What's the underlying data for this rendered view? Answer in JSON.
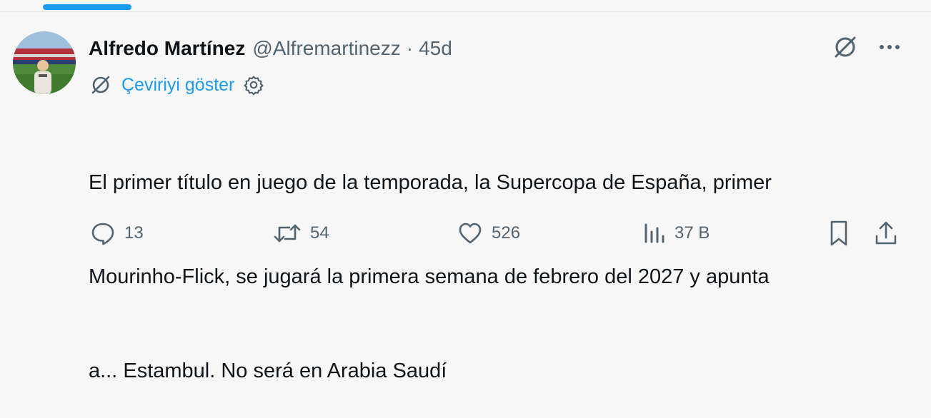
{
  "tweet": {
    "author_name": "Alfredo Martínez",
    "author_handle": "@Alfremartinezz",
    "separator": "·",
    "timestamp": "45d",
    "translate_label": "Çeviriyi göster",
    "text_lines": [
      "El primer título en juego de la temporada, la Supercopa de España, primer",
      "Mourinho-Flick,  se jugará la primera semana de febrero del 2027 y apunta",
      "a... Estambul. No será en Arabia Saudí"
    ]
  },
  "stats": {
    "replies": "13",
    "reposts": "54",
    "likes": "526",
    "views": "37 B"
  },
  "icons": {
    "translate": "translate-icon",
    "more": "more-icon",
    "settings": "gear-icon",
    "reply": "reply-icon",
    "repost": "repost-icon",
    "like": "heart-icon",
    "views": "views-icon",
    "bookmark": "bookmark-icon",
    "share": "share-icon"
  },
  "colors": {
    "accent": "#1d9bf0",
    "muted": "#536471",
    "text": "#0f1419",
    "background": "#f7f7f7"
  }
}
